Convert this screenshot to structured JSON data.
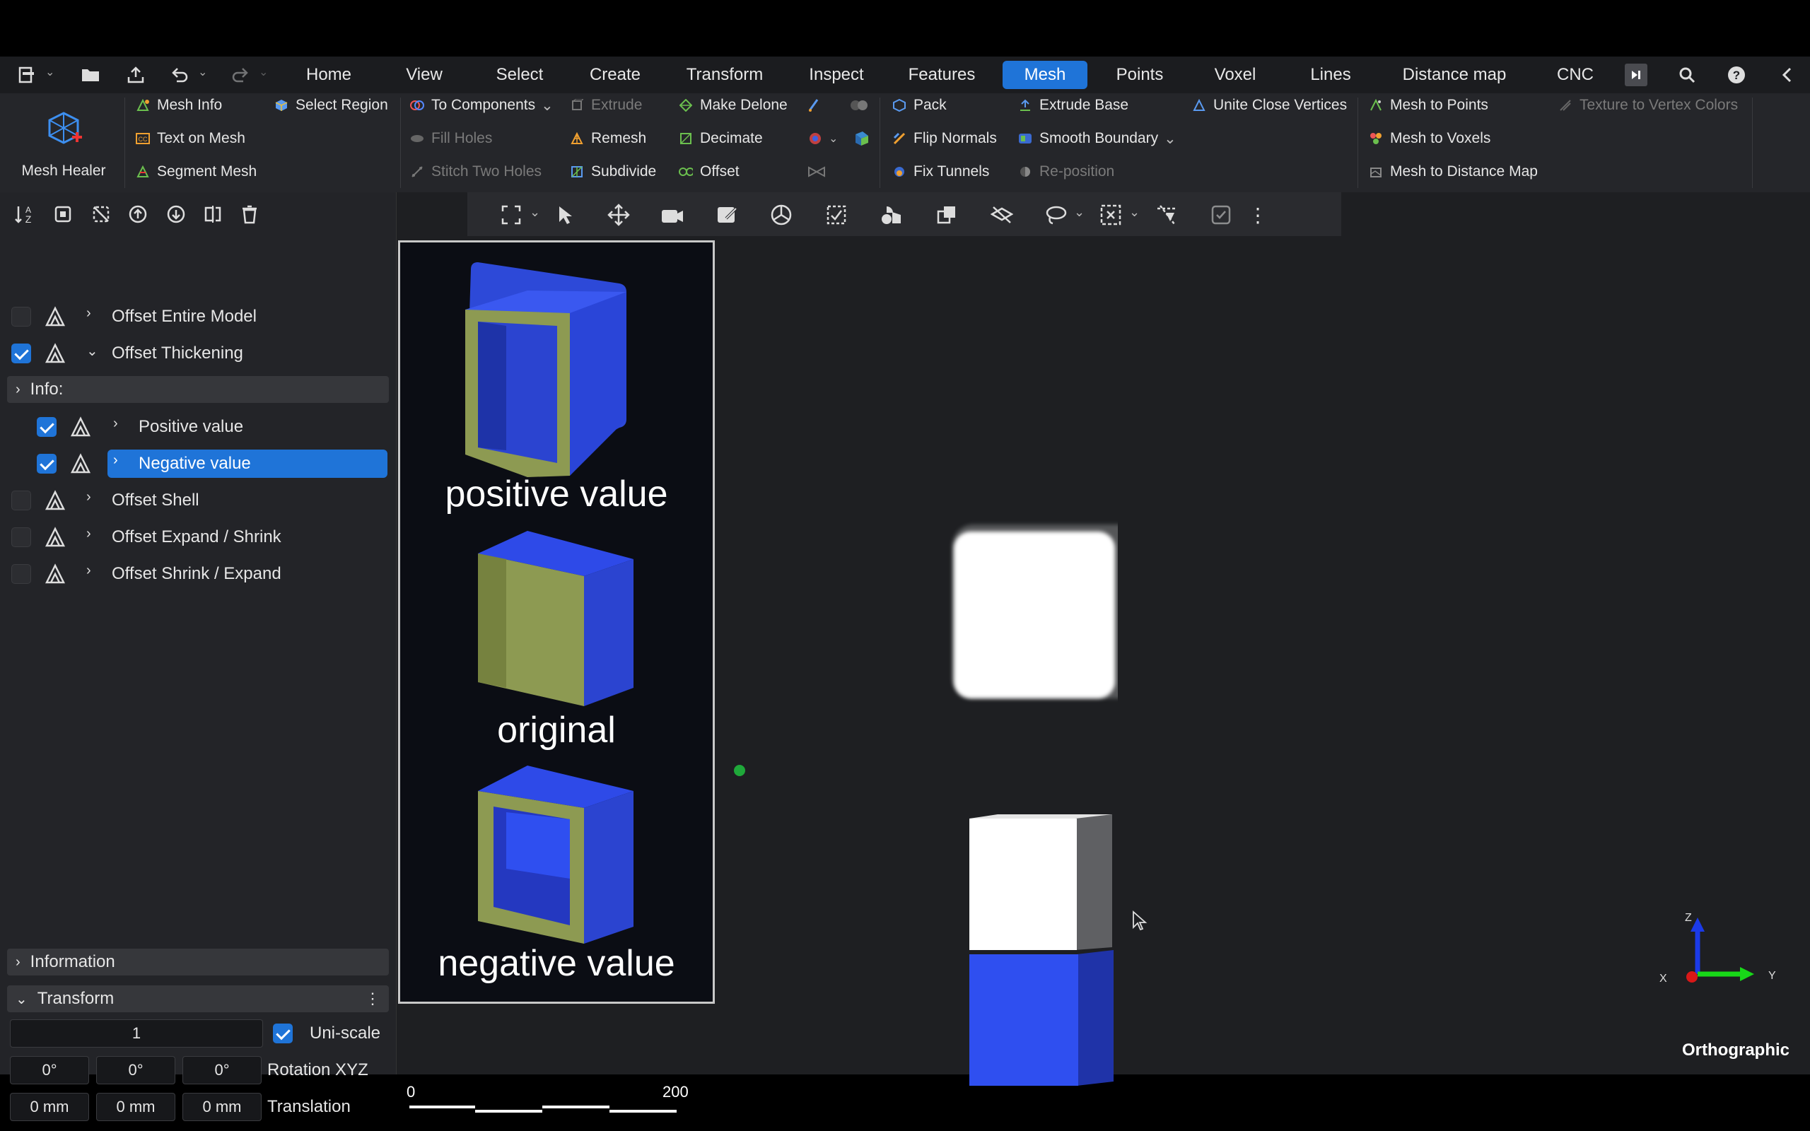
{
  "menubar": {
    "tabs": [
      "Home",
      "View",
      "Select",
      "Create",
      "Transform",
      "Inspect",
      "Features",
      "Mesh",
      "Points",
      "Voxel",
      "Lines",
      "Distance map",
      "CNC"
    ],
    "active_tab": "Mesh"
  },
  "ribbon": {
    "healer_label": "Mesh Healer",
    "col1": [
      "Mesh Info",
      "Text on Mesh",
      "Segment Mesh"
    ],
    "select_region": "Select Region",
    "to_components": "To Components",
    "fill_holes": "Fill Holes",
    "stitch_two_holes": "Stitch Two Holes",
    "extrude": "Extrude",
    "remesh": "Remesh",
    "subdivide": "Subdivide",
    "make_delone": "Make Delone",
    "decimate": "Decimate",
    "offset": "Offset",
    "pack": "Pack",
    "flip_normals": "Flip Normals",
    "fix_tunnels": "Fix Tunnels",
    "extrude_base": "Extrude Base",
    "smooth_boundary": "Smooth Boundary",
    "reposition": "Re-position",
    "unite_close_vertices": "Unite Close Vertices",
    "mesh_to_points": "Mesh to Points",
    "mesh_to_voxels": "Mesh to Voxels",
    "mesh_to_distance_map": "Mesh to Distance Map",
    "texture_to_vertex_colors": "Texture to Vertex Colors"
  },
  "tree": {
    "offset_entire_model": "Offset Entire Model",
    "offset_thickening": "Offset Thickening",
    "info": "Info:",
    "positive_value": "Positive value",
    "negative_value": "Negative value",
    "offset_shell": "Offset Shell",
    "offset_expand_shrink": "Offset Expand / Shrink",
    "offset_shrink_expand": "Offset Shrink / Expand"
  },
  "panels": {
    "information": "Information",
    "transform": "Transform"
  },
  "transform": {
    "scale": "1",
    "uniscale_label": "Uni-scale",
    "rot_x": "0°",
    "rot_y": "0°",
    "rot_z": "0°",
    "rotation_label": "Rotation XYZ",
    "tr_x": "0 mm",
    "tr_y": "0 mm",
    "tr_z": "0 mm",
    "translation_label": "Translation"
  },
  "image_overlay": {
    "captions": [
      "positive value",
      "original",
      "negative value"
    ]
  },
  "scale_bar": {
    "min": "0",
    "max": "200"
  },
  "viewport": {
    "projection": "Orthographic",
    "axes": {
      "z": "Z",
      "x": "X",
      "y": "Y"
    }
  },
  "colors": {
    "accent": "#1f74d8",
    "cube_blue": "#2f4ff0",
    "cube_olive": "#8d9a52"
  }
}
